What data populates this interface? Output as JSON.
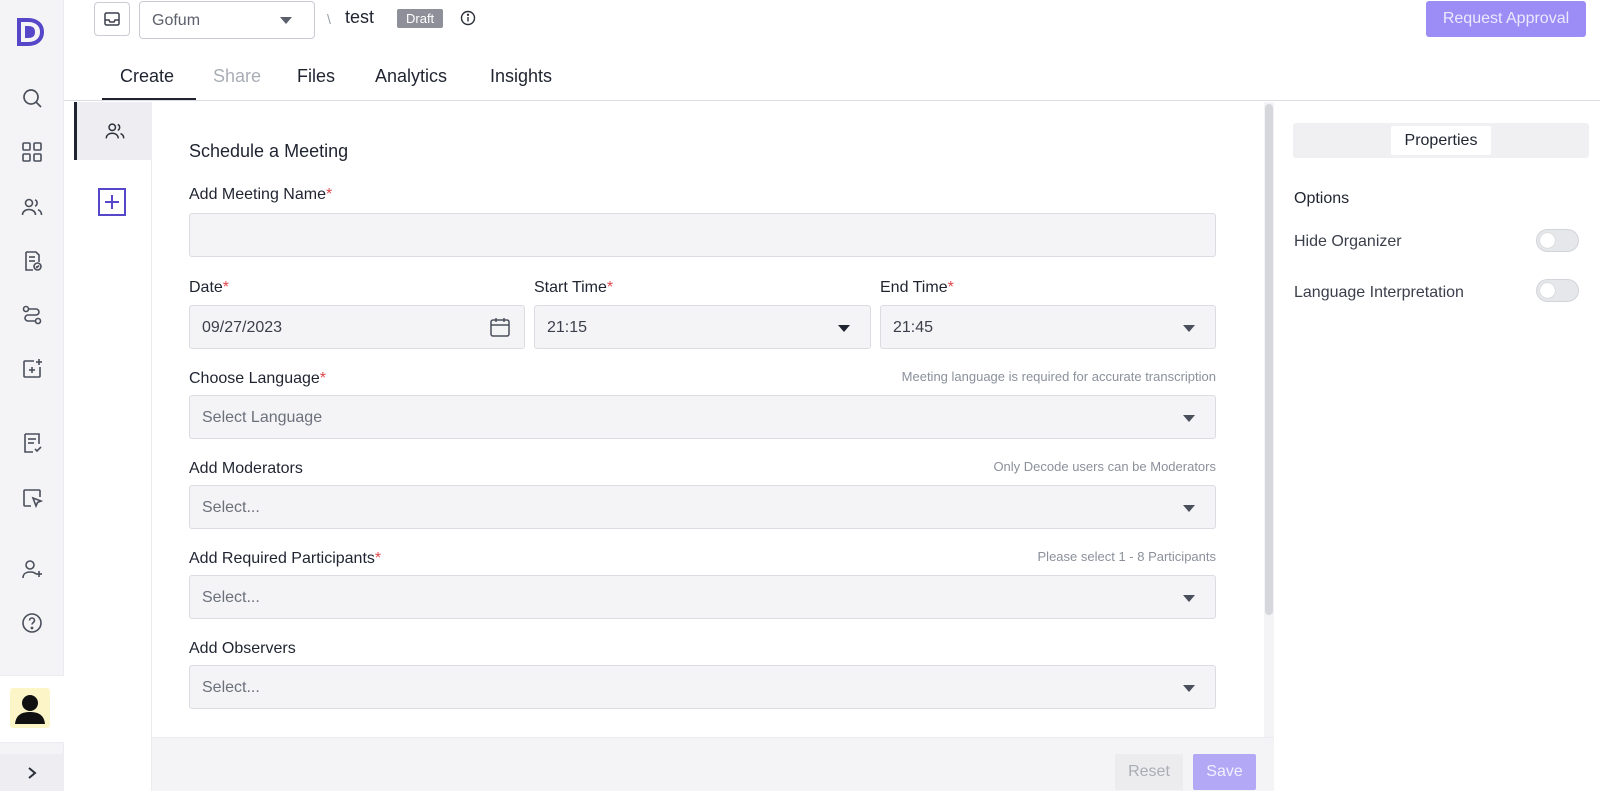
{
  "app": {
    "logo_letter": "D",
    "brand_color": "#5646c8",
    "rail_icons": [
      "search-icon",
      "grid-icon",
      "users-icon",
      "document-check-icon",
      "route-icon",
      "add-box-icon",
      "checklist-icon",
      "cursor-box-icon",
      "add-user-icon",
      "help-icon"
    ],
    "expand_icon": "chevron-right-icon"
  },
  "header": {
    "project_select": "Gofum",
    "separator": "\\",
    "breadcrumb": "test",
    "status_badge": "Draft",
    "request_approval_label": "Request Approval",
    "request_approval_color": "#9c8cf6"
  },
  "tabs": [
    {
      "label": "Create",
      "active": true
    },
    {
      "label": "Share",
      "disabled": true
    },
    {
      "label": "Files"
    },
    {
      "label": "Analytics"
    },
    {
      "label": "Insights"
    }
  ],
  "form": {
    "title": "Schedule a Meeting",
    "meeting_name": {
      "label": "Add Meeting Name",
      "required": "*",
      "value": ""
    },
    "date": {
      "label": "Date",
      "required": "*",
      "value": "09/27/2023"
    },
    "start_time": {
      "label": "Start Time",
      "required": "*",
      "value": "21:15"
    },
    "end_time": {
      "label": "End Time",
      "required": "*",
      "value": "21:45"
    },
    "language": {
      "label": "Choose Language",
      "required": "*",
      "hint": "Meeting language is required for accurate transcription",
      "placeholder": "Select Language"
    },
    "moderators": {
      "label": "Add Moderators",
      "hint": "Only Decode users can be Moderators",
      "placeholder": "Select..."
    },
    "participants": {
      "label": "Add Required Participants",
      "required": "*",
      "hint": "Please select 1 - 8 Participants",
      "placeholder": "Select..."
    },
    "observers": {
      "label": "Add Observers",
      "placeholder": "Select..."
    },
    "reset_label": "Reset",
    "save_label": "Save"
  },
  "properties": {
    "tab_label": "Properties",
    "options_heading": "Options",
    "options": [
      {
        "label": "Hide Organizer",
        "enabled": false
      },
      {
        "label": "Language Interpretation",
        "enabled": false
      }
    ]
  }
}
